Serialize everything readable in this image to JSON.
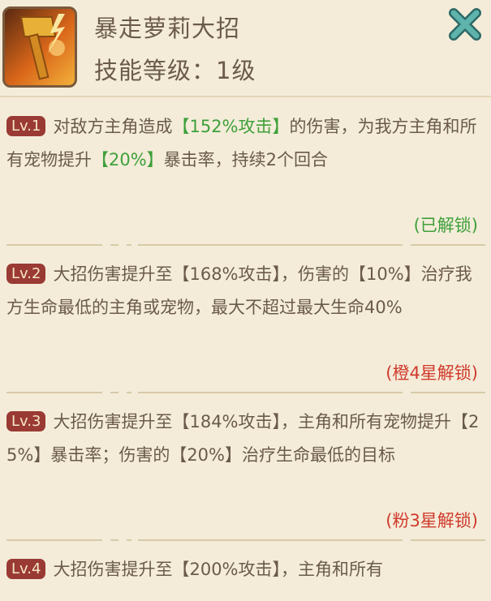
{
  "skill": {
    "title": "暴走萝莉大招",
    "level_text": "技能等级：1级",
    "icon": "hammer-icon"
  },
  "close": {
    "icon": "close-icon"
  },
  "entries": [
    {
      "badge": "Lv.1",
      "segments": [
        "对敌方主角造成",
        "【152%攻击】",
        "的伤害，为我方主角和所有宠物提升",
        "【20%】",
        "暴击率，持续2个回合"
      ],
      "status": "(已解锁)",
      "status_color": "#3fa03a"
    },
    {
      "badge": "Lv.2",
      "text": "大招伤害提升至【168%攻击】，伤害的【10%】治疗我方生命最低的主角或宠物，最大不超过最大生命40%",
      "status": "(橙4星解锁)",
      "status_color": "#d03a2c"
    },
    {
      "badge": "Lv.3",
      "text": "大招伤害提升至【184%攻击】，主角和所有宠物提升【25%】暴击率；伤害的【20%】治疗生命最低的目标",
      "status": "(粉3星解锁)",
      "status_color": "#d03a2c"
    },
    {
      "badge": "Lv.4",
      "text": "大招伤害提升至【200%攻击】，主角和所有"
    }
  ],
  "colors": {
    "background": "#f4ecd9",
    "text": "#6b5a4a",
    "badge": "#9a3a34",
    "highlight_green": "#3fa03a",
    "locked_red": "#d03a2c",
    "close_teal": "#3e8f8a"
  }
}
